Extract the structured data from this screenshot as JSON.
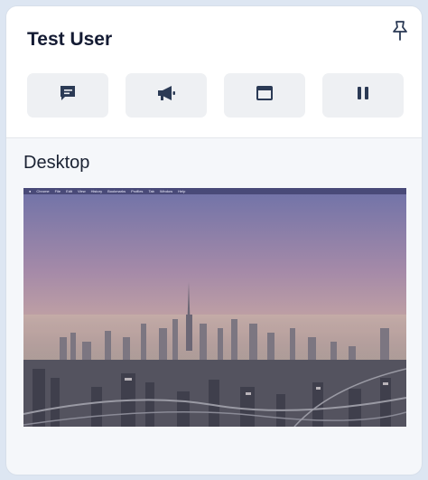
{
  "user": {
    "name": "Test User"
  },
  "icons": {
    "pin": "pin-icon",
    "chat": "chat-icon",
    "announce": "megaphone-icon",
    "window": "window-icon",
    "pause": "pause-icon"
  },
  "section": {
    "title": "Desktop"
  },
  "desktop_menubar": [
    "Chrome",
    "File",
    "Edit",
    "View",
    "History",
    "Bookmarks",
    "Profiles",
    "Tab",
    "Window",
    "Help"
  ],
  "colors": {
    "accent": "#2b3a55",
    "card_bg": "#f5f7fa",
    "button_bg": "#eef0f3"
  }
}
